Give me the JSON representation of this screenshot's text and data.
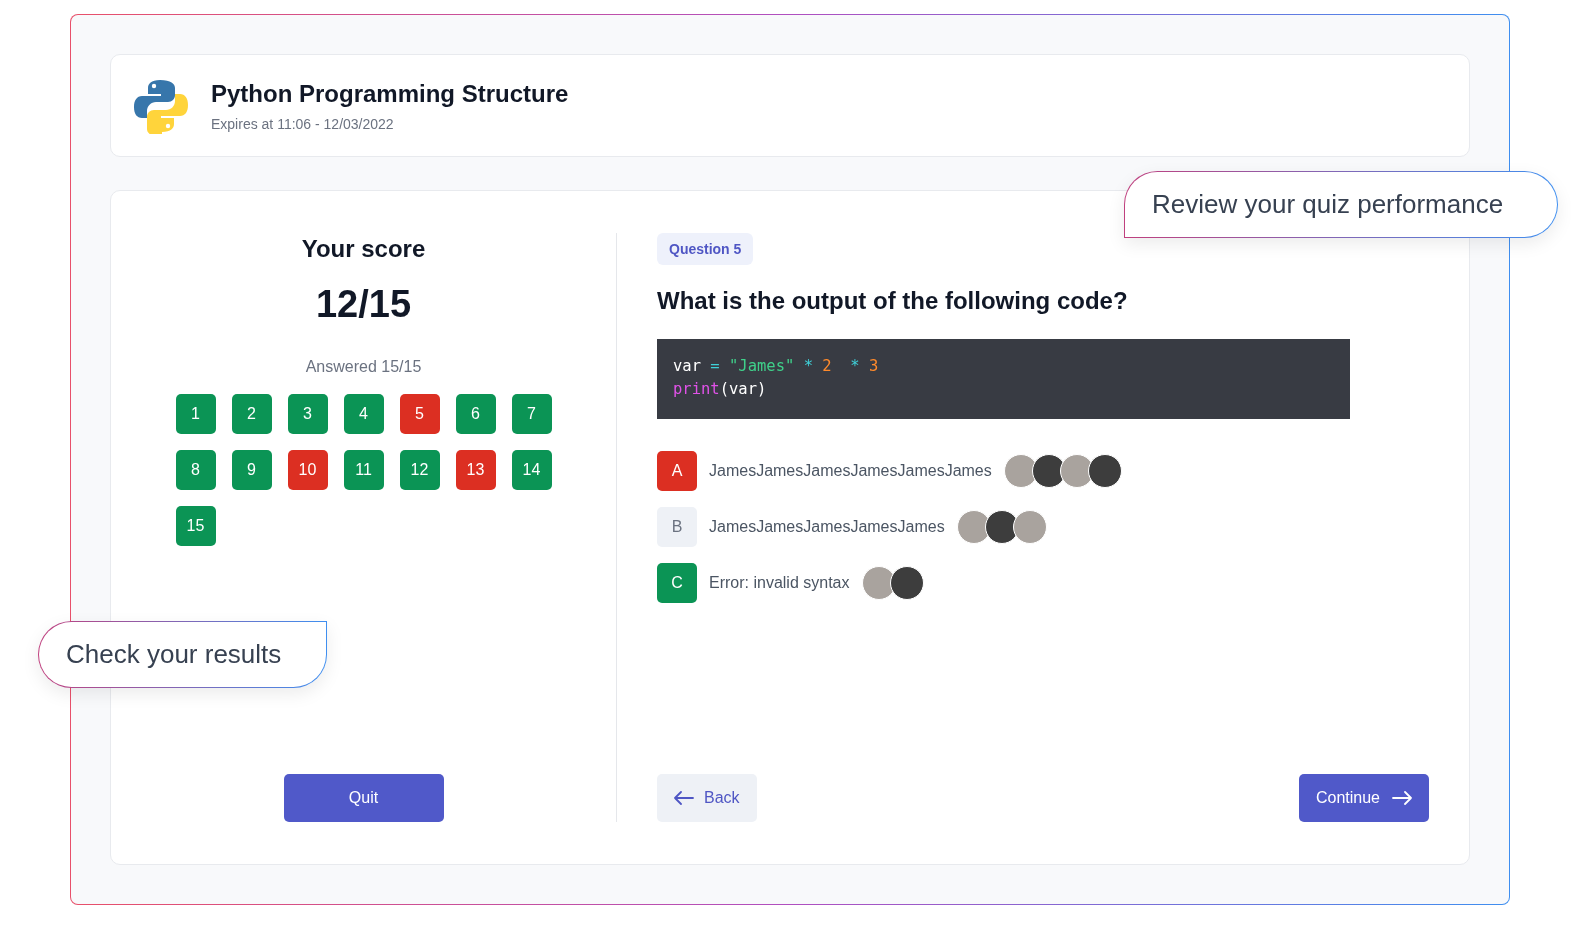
{
  "header": {
    "title": "Python Programming Structure",
    "subtitle": "Expires at 11:06 - 12/03/2022"
  },
  "score": {
    "title": "Your score",
    "value": "12/15",
    "answered": "Answered 15/15",
    "questions": [
      {
        "label": "1",
        "kind": "correct"
      },
      {
        "label": "2",
        "kind": "correct"
      },
      {
        "label": "3",
        "kind": "correct"
      },
      {
        "label": "4",
        "kind": "correct"
      },
      {
        "label": "5",
        "kind": "wrong"
      },
      {
        "label": "6",
        "kind": "correct"
      },
      {
        "label": "7",
        "kind": "correct"
      },
      {
        "label": "8",
        "kind": "correct"
      },
      {
        "label": "9",
        "kind": "correct"
      },
      {
        "label": "10",
        "kind": "wrong"
      },
      {
        "label": "11",
        "kind": "correct"
      },
      {
        "label": "12",
        "kind": "correct"
      },
      {
        "label": "13",
        "kind": "wrong"
      },
      {
        "label": "14",
        "kind": "correct"
      },
      {
        "label": "15",
        "kind": "correct"
      }
    ],
    "quit": "Quit"
  },
  "question": {
    "badge": "Question 5",
    "text": "What is the output of the following code?",
    "code": [
      [
        {
          "kind": "plain",
          "text": "var "
        },
        {
          "kind": "op",
          "text": "= "
        },
        {
          "kind": "string",
          "text": "\"James\" "
        },
        {
          "kind": "op",
          "text": "* "
        },
        {
          "kind": "number",
          "text": "2  "
        },
        {
          "kind": "op",
          "text": "* "
        },
        {
          "kind": "number",
          "text": "3"
        }
      ],
      [
        {
          "kind": "keyword",
          "text": "print"
        },
        {
          "kind": "plain",
          "text": "(var)"
        }
      ]
    ],
    "answers": [
      {
        "letter": "A",
        "text": "JamesJamesJamesJamesJamesJames",
        "kind": "wrong",
        "avatars": [
          {
            "kind": "photo"
          },
          {
            "kind": "photo"
          },
          {
            "kind": "photo"
          },
          {
            "kind": "photo"
          }
        ]
      },
      {
        "letter": "B",
        "text": "JamesJamesJamesJamesJames",
        "kind": "neutral",
        "avatars": [
          {
            "kind": "photo"
          },
          {
            "kind": "photo"
          },
          {
            "kind": "photo"
          }
        ]
      },
      {
        "letter": "C",
        "text": "Error: invalid syntax",
        "kind": "correct",
        "avatars": [
          {
            "kind": "photo"
          },
          {
            "kind": "photo"
          }
        ]
      }
    ],
    "back": "Back",
    "continue": "Continue"
  },
  "callouts": [
    {
      "text": "Review your quiz performance",
      "kind": "right"
    },
    {
      "text": "Check your results",
      "kind": "left"
    }
  ]
}
